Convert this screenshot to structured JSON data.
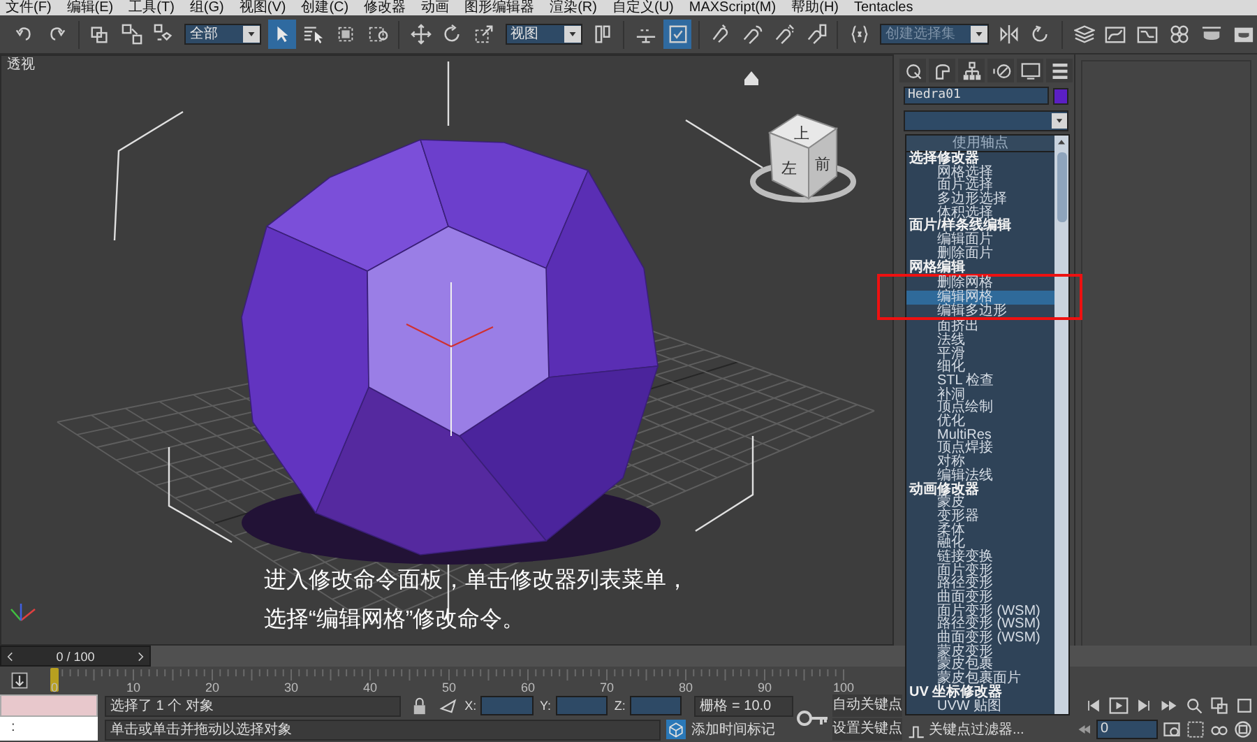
{
  "menu_bar": [
    "文件(F)",
    "编辑(E)",
    "工具(T)",
    "组(G)",
    "视图(V)",
    "创建(C)",
    "修改器",
    "动画",
    "图形编辑器",
    "渲染(R)",
    "自定义(U)",
    "MAXScript(M)",
    "帮助(H)",
    "Tentacles"
  ],
  "toolbar": {
    "selection_filter": "全部",
    "reference_coordinate": "视图",
    "named_selection_set": "创建选择集",
    "tools": [
      {
        "selected": false
      },
      {
        "selected": false
      },
      {
        "selected": false
      },
      {
        "selected": false
      },
      {
        "selected": false
      },
      {
        "selected": true
      },
      {
        "selected": false
      },
      {
        "selected": false
      },
      {
        "selected": false
      },
      {
        "selected": false
      },
      {
        "selected": false
      },
      {
        "selected": false
      },
      {
        "selected": false
      },
      {
        "selected": false
      },
      {
        "selected": true
      },
      {
        "selected": false
      },
      {
        "selected": false
      },
      {
        "selected": false
      },
      {
        "selected": false
      },
      {
        "selected": false
      },
      {
        "selected": false
      },
      {
        "selected": false
      },
      {
        "selected": false
      },
      {
        "selected": false
      },
      {
        "selected": false
      },
      {
        "selected": false
      },
      {
        "selected": false
      },
      {
        "selected": false
      }
    ]
  },
  "viewport": {
    "label": "透视",
    "viewcube": [
      "上",
      "左",
      "前"
    ],
    "caption": [
      "进入修改命令面板，单击修改器列表菜单，",
      "选择“编辑网格”修改命令。"
    ]
  },
  "command_panel": {
    "object_name": "Hedra01",
    "modifier_list": {
      "header": "使用轴点",
      "items": [
        {
          "kind": "heading",
          "label": "选择修改器",
          "selected": false
        },
        {
          "kind": "item",
          "label": "网格选择",
          "selected": false
        },
        {
          "kind": "item",
          "label": "面片选择",
          "selected": false
        },
        {
          "kind": "item",
          "label": "多边形选择",
          "selected": false
        },
        {
          "kind": "item",
          "label": "体积选择",
          "selected": false
        },
        {
          "kind": "heading",
          "label": "面片/样条线编辑",
          "selected": false
        },
        {
          "kind": "item",
          "label": "编辑面片",
          "selected": false
        },
        {
          "kind": "item",
          "label": "删除面片",
          "selected": false
        },
        {
          "kind": "heading",
          "label": "网格编辑",
          "selected": false
        },
        {
          "kind": "item",
          "label": "删除网格",
          "selected": false,
          "boxed": true
        },
        {
          "kind": "item",
          "label": "编辑网格",
          "selected": true,
          "boxed": true
        },
        {
          "kind": "item",
          "label": "编辑多边形",
          "selected": false,
          "boxed": true
        },
        {
          "kind": "item",
          "label": "面挤出",
          "selected": false
        },
        {
          "kind": "item",
          "label": "法线",
          "selected": false
        },
        {
          "kind": "item",
          "label": "平滑",
          "selected": false
        },
        {
          "kind": "item",
          "label": "细化",
          "selected": false
        },
        {
          "kind": "item",
          "label": "STL 检查",
          "selected": false
        },
        {
          "kind": "item",
          "label": "补洞",
          "selected": false
        },
        {
          "kind": "item",
          "label": "顶点绘制",
          "selected": false
        },
        {
          "kind": "item",
          "label": "优化",
          "selected": false
        },
        {
          "kind": "item",
          "label": "MultiRes",
          "selected": false
        },
        {
          "kind": "item",
          "label": "顶点焊接",
          "selected": false
        },
        {
          "kind": "item",
          "label": "对称",
          "selected": false
        },
        {
          "kind": "item",
          "label": "编辑法线",
          "selected": false
        },
        {
          "kind": "heading",
          "label": "动画修改器",
          "selected": false
        },
        {
          "kind": "item",
          "label": "蒙皮",
          "selected": false
        },
        {
          "kind": "item",
          "label": "变形器",
          "selected": false
        },
        {
          "kind": "item",
          "label": "柔体",
          "selected": false
        },
        {
          "kind": "item",
          "label": "融化",
          "selected": false
        },
        {
          "kind": "item",
          "label": "链接变换",
          "selected": false
        },
        {
          "kind": "item",
          "label": "面片变形",
          "selected": false
        },
        {
          "kind": "item",
          "label": "路径变形",
          "selected": false
        },
        {
          "kind": "item",
          "label": "曲面变形",
          "selected": false
        },
        {
          "kind": "item",
          "label": "面片变形 (WSM)",
          "selected": false
        },
        {
          "kind": "item",
          "label": "路径变形 (WSM)",
          "selected": false
        },
        {
          "kind": "item",
          "label": "曲面变形 (WSM)",
          "selected": false
        },
        {
          "kind": "item",
          "label": "蒙皮变形",
          "selected": false
        },
        {
          "kind": "item",
          "label": "蒙皮包裹",
          "selected": false
        },
        {
          "kind": "item",
          "label": "蒙皮包裹面片",
          "selected": false
        },
        {
          "kind": "heading",
          "label": "UV 坐标修改器",
          "selected": false
        },
        {
          "kind": "item",
          "label": "UVW 贴图",
          "selected": false
        }
      ]
    }
  },
  "time_slider": {
    "position": "0 / 100",
    "frame_labels": [
      "0",
      "10",
      "20",
      "30",
      "40",
      "50",
      "60",
      "70",
      "80",
      "90",
      "100"
    ]
  },
  "status_bar": {
    "listener_prompt": ":",
    "selection_info": "选择了 1 个 对象",
    "prompt": "单击或单击并拖动以选择对象",
    "coord_labels": [
      "X:",
      "Y:",
      "Z:"
    ],
    "grid": "栅格 = 10.0",
    "add_time_tag": "添加时间标记",
    "auto_key": "自动关键点",
    "set_key": "设置关键点",
    "key_filters": "关键点过滤器...",
    "current_frame": "0"
  }
}
